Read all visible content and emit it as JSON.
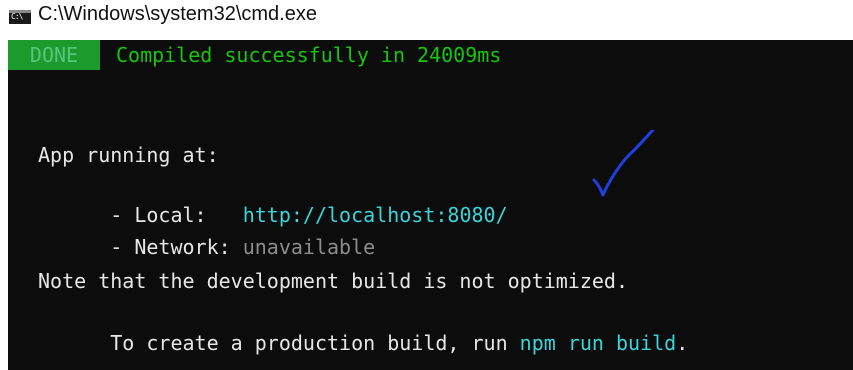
{
  "window": {
    "title": "C:\\Windows\\system32\\cmd.exe",
    "icon": "cmd-icon",
    "icon_text": "C:\\"
  },
  "console": {
    "done_label": "DONE",
    "compiled_message": "Compiled successfully in 24009ms",
    "app_running": "App running at:",
    "local_label": "- Local:   ",
    "local_url": "http://localhost:8080/",
    "network_label": "- Network: ",
    "network_value": "unavailable",
    "note_line": "Note that the development build is not optimized.",
    "create_prefix": "To create a production build, run ",
    "create_command": "npm run build",
    "create_suffix": "."
  },
  "colors": {
    "console_bg": "#0c0c0c",
    "done_bg": "#1c9b2c",
    "success_green": "#16c60c",
    "url_cyan": "#3ad4d9",
    "text_white": "#e6e6e6",
    "muted_gray": "#8c8c8c",
    "annotation_blue": "#1f3fe0"
  }
}
